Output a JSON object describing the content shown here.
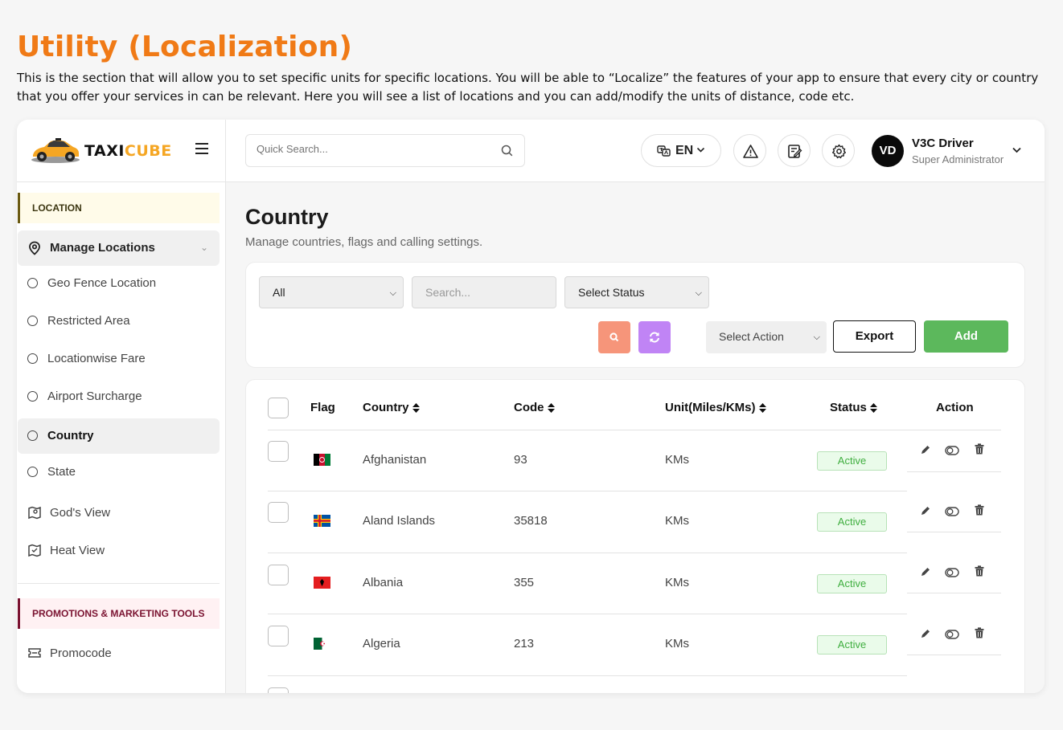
{
  "page": {
    "title": "Utility (Localization)",
    "description": "This is the section that will allow you to set specific units for specific locations. You will be able to “Localize” the features of your app to ensure that every city or country that you offer your services in can be relevant. Here you will see a list of locations and you can add/modify the units of distance, code etc."
  },
  "brand": {
    "part1": "TAXI",
    "part2": "CUBE"
  },
  "sidebar": {
    "section_location": "LOCATION",
    "group_label": "Manage Locations",
    "items": [
      {
        "label": "Geo Fence Location"
      },
      {
        "label": "Restricted Area"
      },
      {
        "label": "Locationwise Fare"
      },
      {
        "label": "Airport Surcharge"
      },
      {
        "label": "Country"
      },
      {
        "label": "State"
      }
    ],
    "gods_view": "God's View",
    "heat_view": "Heat View",
    "section_promo": "PROMOTIONS & MARKETING TOOLS",
    "promocode": "Promocode"
  },
  "header": {
    "search_placeholder": "Quick Search...",
    "language": "EN",
    "user_initials": "VD",
    "user_name": "V3C Driver",
    "user_role": "Super Administrator"
  },
  "main": {
    "title": "Country",
    "subtitle": "Manage countries, flags and calling settings.",
    "filter_all": "All",
    "search_placeholder": "Search...",
    "select_status": "Select Status",
    "select_action": "Select Action",
    "export_label": "Export",
    "add_label": "Add"
  },
  "table": {
    "columns": [
      "Flag",
      "Country",
      "Code",
      "Unit(Miles/KMs)",
      "Status",
      "Action"
    ],
    "rows": [
      {
        "country": "Afghanistan",
        "code": "93",
        "unit": "KMs",
        "status": "Active"
      },
      {
        "country": "Aland Islands",
        "code": "35818",
        "unit": "KMs",
        "status": "Active"
      },
      {
        "country": "Albania",
        "code": "355",
        "unit": "KMs",
        "status": "Active"
      },
      {
        "country": "Algeria",
        "code": "213",
        "unit": "KMs",
        "status": "Active"
      }
    ]
  },
  "colors": {
    "title_orange": "#f07a16",
    "brand_yellow": "#f5a623",
    "add_green": "#5cb85c",
    "search_btn": "#f6957a",
    "refresh_btn": "#c084f5",
    "active_green": "#3fae3f"
  }
}
